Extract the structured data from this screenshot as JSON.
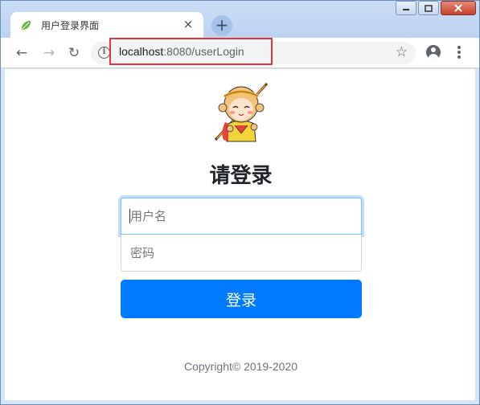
{
  "browser": {
    "tab_title": "用户登录界面",
    "tab_close": "×",
    "new_tab": "+",
    "url_host": "localhost",
    "url_rest": ":8080/userLogin",
    "window_controls": {
      "minimize": "▭",
      "maximize": "▢",
      "close": "✕"
    },
    "nav": {
      "back": "←",
      "forward": "→",
      "reload": "↻"
    },
    "info": "i",
    "star": "☆"
  },
  "login": {
    "heading": "请登录",
    "username_placeholder": "用户名",
    "password_placeholder": "密码",
    "submit_label": "登录"
  },
  "footer": {
    "copyright": "Copyright© 2019-2020"
  },
  "colors": {
    "primary": "#007bff",
    "url_highlight": "#e8333b"
  }
}
